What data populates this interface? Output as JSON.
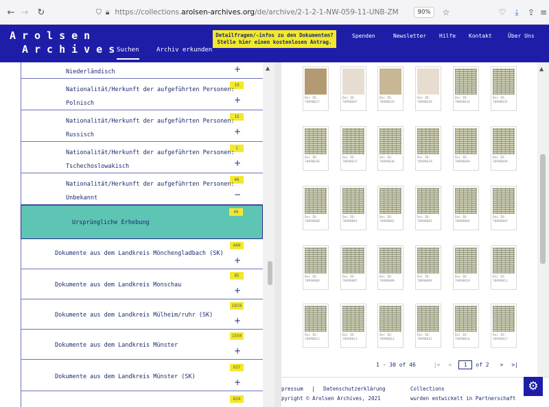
{
  "browser": {
    "url_host_prefix": "https://collections.",
    "url_host_bold": "arolsen-archives.org",
    "url_path": "/de/archive/2-1-2-1-NW-059-11-UNB-ZM",
    "zoom": "90%"
  },
  "header": {
    "logo_line1": "Arolsen",
    "logo_line2": "Archives",
    "tab_search": "Suchen",
    "tab_explore": "Archiv erkunden",
    "notice_line1": "Detailfragen/-infos zu den Dokumenten?",
    "notice_line2": "Stelle hier einen kostenlosen Antrag.",
    "links": [
      "Spenden",
      "Newsletter",
      "Hilfe",
      "Kontakt",
      "Über Uns"
    ]
  },
  "tree": {
    "rows": [
      {
        "text": "Niederländisch",
        "badge": "",
        "sign": "+"
      },
      {
        "text": "Nationalität/Herkunft der aufgeführten Personen:",
        "text2": "Polnisch",
        "badge": "19",
        "sign": "+"
      },
      {
        "text": "Nationalität/Herkunft der aufgeführten Personen:",
        "text2": "Russisch",
        "badge": "15",
        "sign": "+"
      },
      {
        "text": "Nationalität/Herkunft der aufgeführten Personen:",
        "text2": "Tschechoslowakisch",
        "badge": "1",
        "sign": "+"
      },
      {
        "text": "Nationalität/Herkunft der aufgeführten Personen:",
        "text2": "Unbekannt",
        "badge": "46",
        "sign": "−"
      },
      {
        "text": "Ursprüngliche Erhebung",
        "badge": "46",
        "sign": ""
      },
      {
        "text": "Dokumente aus dem Landkreis Mönchengladbach (SK)",
        "badge": "449",
        "sign": "+"
      },
      {
        "text": "Dokumente aus dem Landkreis Monschau",
        "badge": "85",
        "sign": "+"
      },
      {
        "text": "Dokumente aus dem Landkreis Mülheim/ruhr (SK)",
        "badge": "1819",
        "sign": "+"
      },
      {
        "text": "Dokumente aus dem Landkreis Münster",
        "badge": "1550",
        "sign": "+"
      },
      {
        "text": "Dokumente aus dem Landkreis Münster (SK)",
        "badge": "937",
        "sign": "+"
      },
      {
        "text": "",
        "badge": "824",
        "sign": ""
      }
    ]
  },
  "gallery": {
    "caption_label": "Doc ID:",
    "rows": [
      [
        "70998627",
        "70998607",
        "70998626",
        "70998628",
        "70998634",
        "70998635"
      ],
      [
        "70998636",
        "70998637",
        "70998638",
        "70998639",
        "70998698",
        "70998699"
      ],
      [
        "70998880",
        "70998881",
        "70998882",
        "70998883",
        "70998884",
        "70998885"
      ],
      [
        "70998886",
        "70998887",
        "70998888",
        "70998889",
        "70998810",
        "70998811"
      ],
      [
        "70998812",
        "70998813",
        "70998814",
        "70998815",
        "70998816",
        "70998817"
      ]
    ],
    "first_row_tones": [
      "brown",
      "pale",
      "beige",
      "pale",
      "doc",
      "doc"
    ]
  },
  "pager": {
    "range": "1 - 30 of 46",
    "first": "|<",
    "prev": "<",
    "page": "1",
    "of": "of 2",
    "next": ">",
    "last": ">|"
  },
  "footer": {
    "impressum": "pressum",
    "sep": "|",
    "privacy": "Datenschutzerklärung",
    "copyright": "pyright © Arolsen Archives, 2021",
    "col2_line1": "Collections",
    "col2_line2": "wurden entwickelt in Partnerschaft"
  },
  "colors": {
    "brand_blue": "#1d1da8",
    "accent_yellow": "#f2e92e",
    "highlight_teal": "#5ec4b4"
  }
}
